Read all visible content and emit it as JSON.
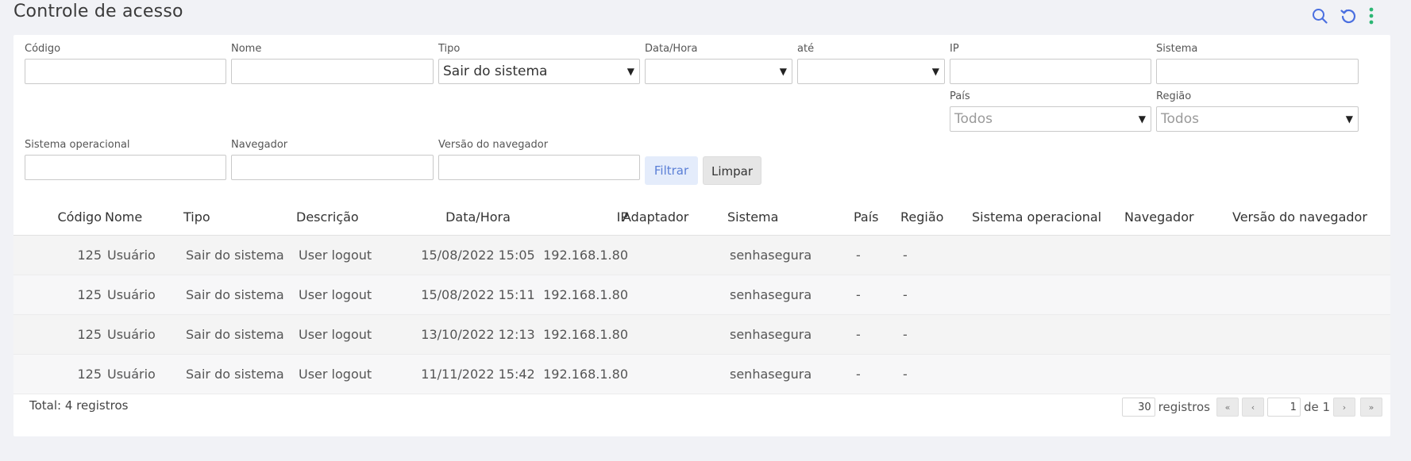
{
  "page": {
    "title": "Controle de acesso"
  },
  "toolbar": {
    "icons": [
      "search-icon",
      "refresh-icon",
      "more-vertical-icon"
    ],
    "accent": "#4a6fe0",
    "more_color": "#2bb673"
  },
  "filters": {
    "codigo": {
      "label": "Código",
      "value": ""
    },
    "nome": {
      "label": "Nome",
      "value": ""
    },
    "tipo": {
      "label": "Tipo",
      "value": "Sair do sistema"
    },
    "data_hora": {
      "label": "Data/Hora",
      "value": ""
    },
    "ate": {
      "label": "até",
      "value": ""
    },
    "ip": {
      "label": "IP",
      "value": ""
    },
    "sistema": {
      "label": "Sistema",
      "value": ""
    },
    "pais": {
      "label": "País",
      "value": "Todos"
    },
    "regiao": {
      "label": "Região",
      "value": "Todos"
    },
    "sistema_operacional": {
      "label": "Sistema operacional",
      "value": ""
    },
    "navegador": {
      "label": "Navegador",
      "value": ""
    },
    "versao_navegador": {
      "label": "Versão do navegador",
      "value": ""
    },
    "filter_button": "Filtrar",
    "clear_button": "Limpar"
  },
  "table": {
    "columns": [
      "Código",
      "Nome",
      "Tipo",
      "Descrição",
      "Data/Hora",
      "IP",
      "Adaptador",
      "Sistema",
      "País",
      "Região",
      "Sistema operacional",
      "Navegador",
      "Versão do navegador"
    ],
    "rows": [
      [
        "125",
        "Usuário",
        "Sair do sistema",
        "User logout",
        "15/08/2022 15:05",
        "192.168.1.80",
        "",
        "senhasegura",
        "-",
        "-",
        "",
        "",
        ""
      ],
      [
        "125",
        "Usuário",
        "Sair do sistema",
        "User logout",
        "15/08/2022 15:11",
        "192.168.1.80",
        "",
        "senhasegura",
        "-",
        "-",
        "",
        "",
        ""
      ],
      [
        "125",
        "Usuário",
        "Sair do sistema",
        "User logout",
        "13/10/2022 12:13",
        "192.168.1.80",
        "",
        "senhasegura",
        "-",
        "-",
        "",
        "",
        ""
      ],
      [
        "125",
        "Usuário",
        "Sair do sistema",
        "User logout",
        "11/11/2022 15:42",
        "192.168.1.80",
        "",
        "senhasegura",
        "-",
        "-",
        "",
        "",
        ""
      ]
    ]
  },
  "footer": {
    "total": "Total: 4 registros",
    "page_size": "30",
    "registros_label": "registros",
    "first": "«",
    "prev": "‹",
    "page": "1",
    "of_label": "de 1",
    "next": "›",
    "last": "»"
  }
}
